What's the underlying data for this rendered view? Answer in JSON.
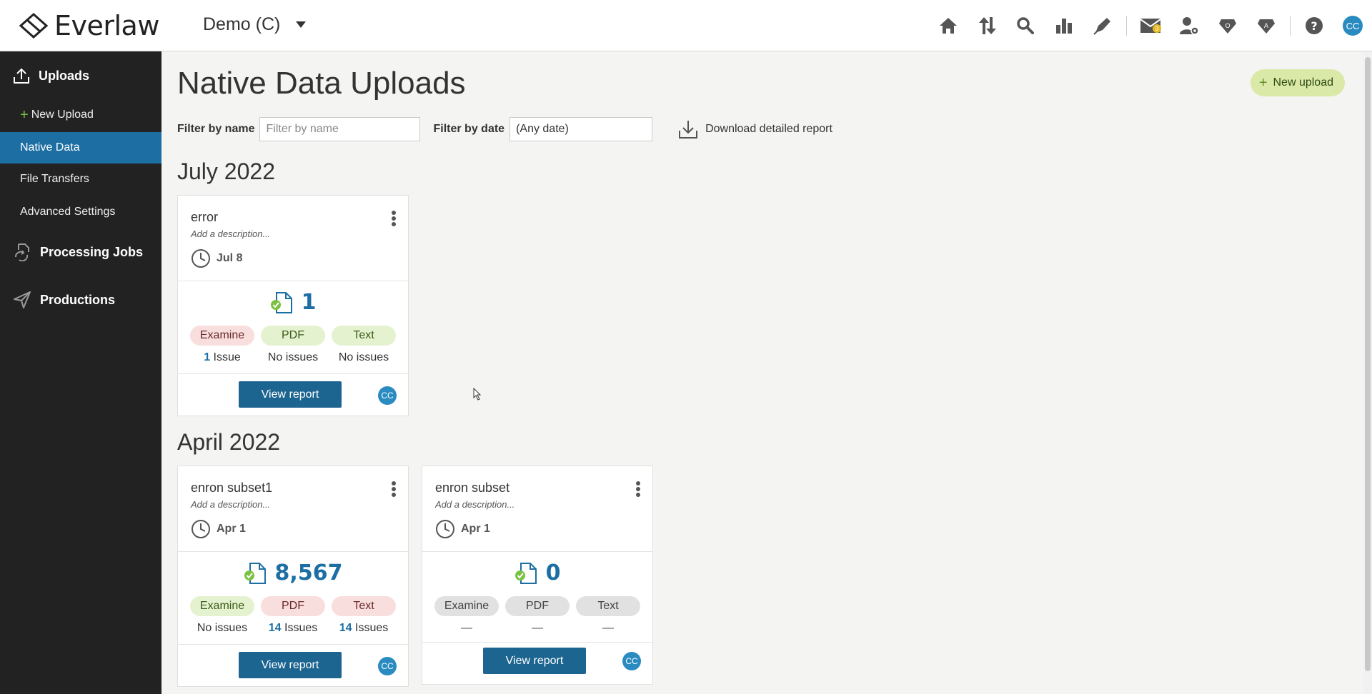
{
  "header": {
    "logo_text": "Everlaw",
    "project_name": "Demo (C)",
    "messages_badge": "3",
    "user_initials": "CC",
    "icons": [
      "home-icon",
      "transfer-icon",
      "search-icon",
      "analytics-icon",
      "pen-icon",
      "mail-icon",
      "user-settings-icon",
      "gem-o-icon",
      "gem-a-icon",
      "help-icon"
    ]
  },
  "sidebar": {
    "sections": [
      {
        "label": "Uploads"
      },
      {
        "label": "Processing Jobs"
      },
      {
        "label": "Productions"
      }
    ],
    "items": [
      {
        "label": "New Upload"
      },
      {
        "label": "Native Data"
      },
      {
        "label": "File Transfers"
      },
      {
        "label": "Advanced Settings"
      }
    ]
  },
  "main": {
    "title": "Native Data Uploads",
    "new_upload_label": "New upload",
    "filters": {
      "name_label": "Filter by name",
      "name_placeholder": "Filter by name",
      "date_label": "Filter by date",
      "date_value": "(Any date)",
      "download_label": "Download detailed report"
    },
    "groups": [
      {
        "month": "July 2022",
        "cards": [
          {
            "title": "error",
            "description": "Add a description...",
            "date": "Jul 8",
            "count": "1",
            "pills": [
              "Examine",
              "PDF",
              "Text"
            ],
            "issues": [
              {
                "num": "1",
                "text": " Issue"
              },
              {
                "num": "",
                "text": "No issues"
              },
              {
                "num": "",
                "text": "No issues"
              }
            ],
            "button": "View report",
            "initials": "CC"
          }
        ]
      },
      {
        "month": "April 2022",
        "cards": [
          {
            "title": "enron subset1",
            "description": "Add a description...",
            "date": "Apr 1",
            "count": "8,567",
            "pills": [
              "Examine",
              "PDF",
              "Text"
            ],
            "issues": [
              {
                "num": "",
                "text": "No issues"
              },
              {
                "num": "14",
                "text": " Issues"
              },
              {
                "num": "14",
                "text": " Issues"
              }
            ],
            "button": "View report",
            "initials": "CC"
          },
          {
            "title": "enron subset",
            "description": "Add a description...",
            "date": "Apr 1",
            "count": "0",
            "pills": [
              "Examine",
              "PDF",
              "Text"
            ],
            "issues": [
              {
                "num": "",
                "text": "—"
              },
              {
                "num": "",
                "text": "—"
              },
              {
                "num": "",
                "text": "—"
              }
            ],
            "button": "View report",
            "initials": "CC"
          }
        ]
      }
    ]
  },
  "colors": {
    "accent": "#1d6fa3",
    "sidebar_bg": "#222222",
    "pill_red": "#f9dede",
    "pill_green": "#e4f2cf",
    "pill_grey": "#e1e1e1"
  }
}
